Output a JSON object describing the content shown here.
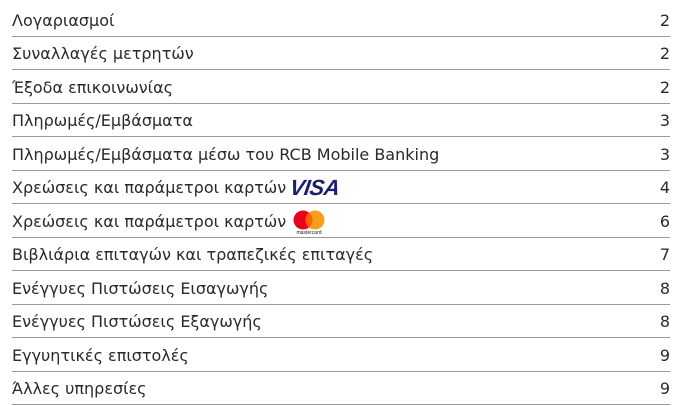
{
  "toc": {
    "items": [
      {
        "title": "Λογαριασμοί",
        "page": "2"
      },
      {
        "title": "Συναλλαγές μετρητών",
        "page": "2"
      },
      {
        "title": "Έξοδα επικοινωνίας",
        "page": "2"
      },
      {
        "title": "Πληρωμές/Εμβάσματα",
        "page": "3"
      },
      {
        "title": "Πληρωμές/Εμβάσματα μέσω του RCB Mobile Banking",
        "page": "3"
      },
      {
        "title": "Χρεώσεις και παράμετροι καρτών",
        "page": "4",
        "logo": "visa-logo",
        "logo_text": "VISA",
        "logo_color": "#1a1f71"
      },
      {
        "title": "Χρεώσεις και παράμετροι καρτών",
        "page": "6",
        "logo": "mastercard-logo",
        "logo_text": "mastercard",
        "logo_colors": [
          "#eb001b",
          "#f79e1b",
          "#ff5f00"
        ]
      },
      {
        "title": "Βιβλιάρια επιταγών και τραπεζικές επιταγές",
        "page": "7"
      },
      {
        "title": "Ενέγγυες Πιστώσεις Εισαγωγής",
        "page": "8"
      },
      {
        "title": "Ενέγγυες Πιστώσεις Εξαγωγής",
        "page": "8"
      },
      {
        "title": "Εγγυητικές επιστολές",
        "page": "9"
      },
      {
        "title": "Άλλες υπηρεσίες",
        "page": "9"
      }
    ]
  }
}
